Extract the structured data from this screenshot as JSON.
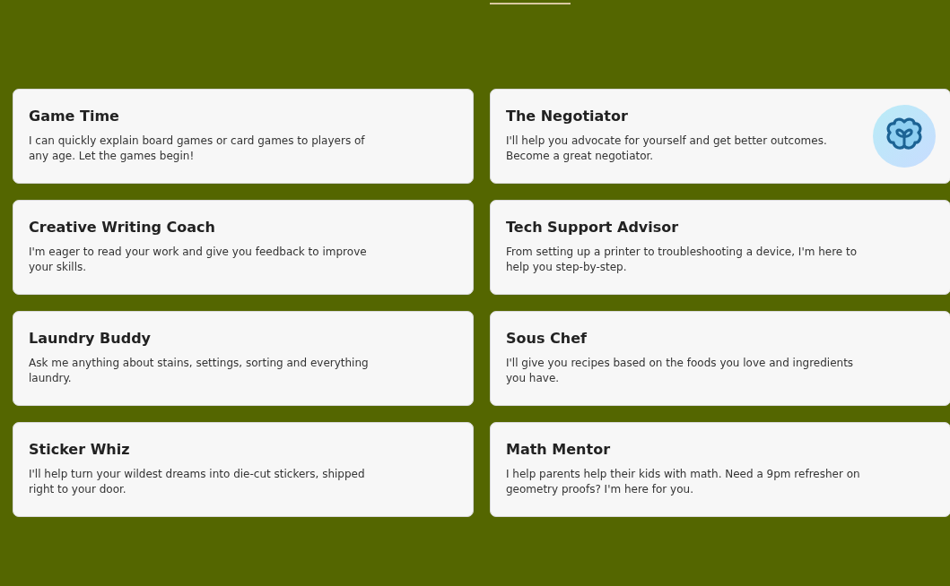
{
  "cards": [
    {
      "title": "Game Time",
      "description": "I can quickly explain board games or card games to players of any age. Let the games begin!",
      "kind": "plain"
    },
    {
      "title": "The Negotiator",
      "description": "I'll help you advocate for yourself and get better outcomes. Become a great negotiator.",
      "kind": "with-icon"
    },
    {
      "title": "Creative Writing Coach",
      "description": "I'm eager to read your work and give you feedback to improve your skills.",
      "kind": "plain"
    },
    {
      "title": "Tech Support Advisor",
      "description": "From setting up a printer to troubleshooting a device, I'm here to help you step-by-step.",
      "kind": "plain"
    },
    {
      "title": "Laundry Buddy",
      "description": "Ask me anything about stains, settings, sorting and everything laundry.",
      "kind": "plain"
    },
    {
      "title": "Sous Chef",
      "description": "I'll give you recipes based on the foods you love and ingredients you have.",
      "kind": "plain"
    },
    {
      "title": "Sticker Whiz",
      "description": "I'll help turn your wildest dreams into die-cut stickers, shipped right to your door.",
      "kind": "plain"
    },
    {
      "title": "Math Mentor",
      "description": "I help parents help their kids with math. Need a 9pm refresher on geometry proofs? I'm here for you.",
      "kind": "plain"
    }
  ]
}
